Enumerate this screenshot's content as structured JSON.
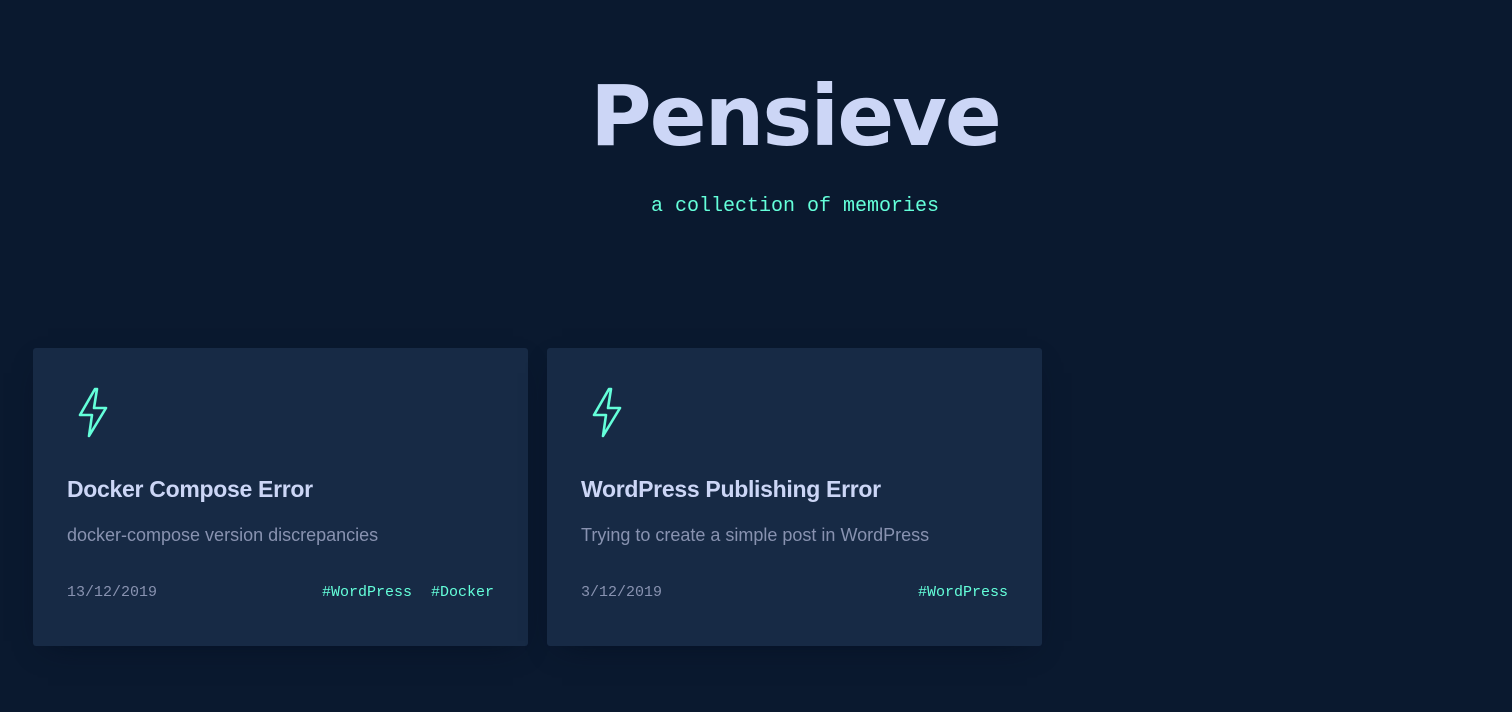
{
  "header": {
    "title": "Pensieve",
    "subtitle": "a collection of memories"
  },
  "theme": {
    "background": "#0a192f",
    "card_background": "#172a45",
    "accent": "#64ffda",
    "heading": "#ccd6f6",
    "body_text": "#8892b0"
  },
  "posts": [
    {
      "icon": "lightning-bolt-icon",
      "title": "Docker Compose Error",
      "description": "docker-compose version discrepancies",
      "date": "13/12/2019",
      "tags": [
        "#WordPress",
        "#Docker"
      ]
    },
    {
      "icon": "lightning-bolt-icon",
      "title": "WordPress Publishing Error",
      "description": "Trying to create a simple post in WordPress",
      "date": "3/12/2019",
      "tags": [
        "#WordPress"
      ]
    }
  ]
}
